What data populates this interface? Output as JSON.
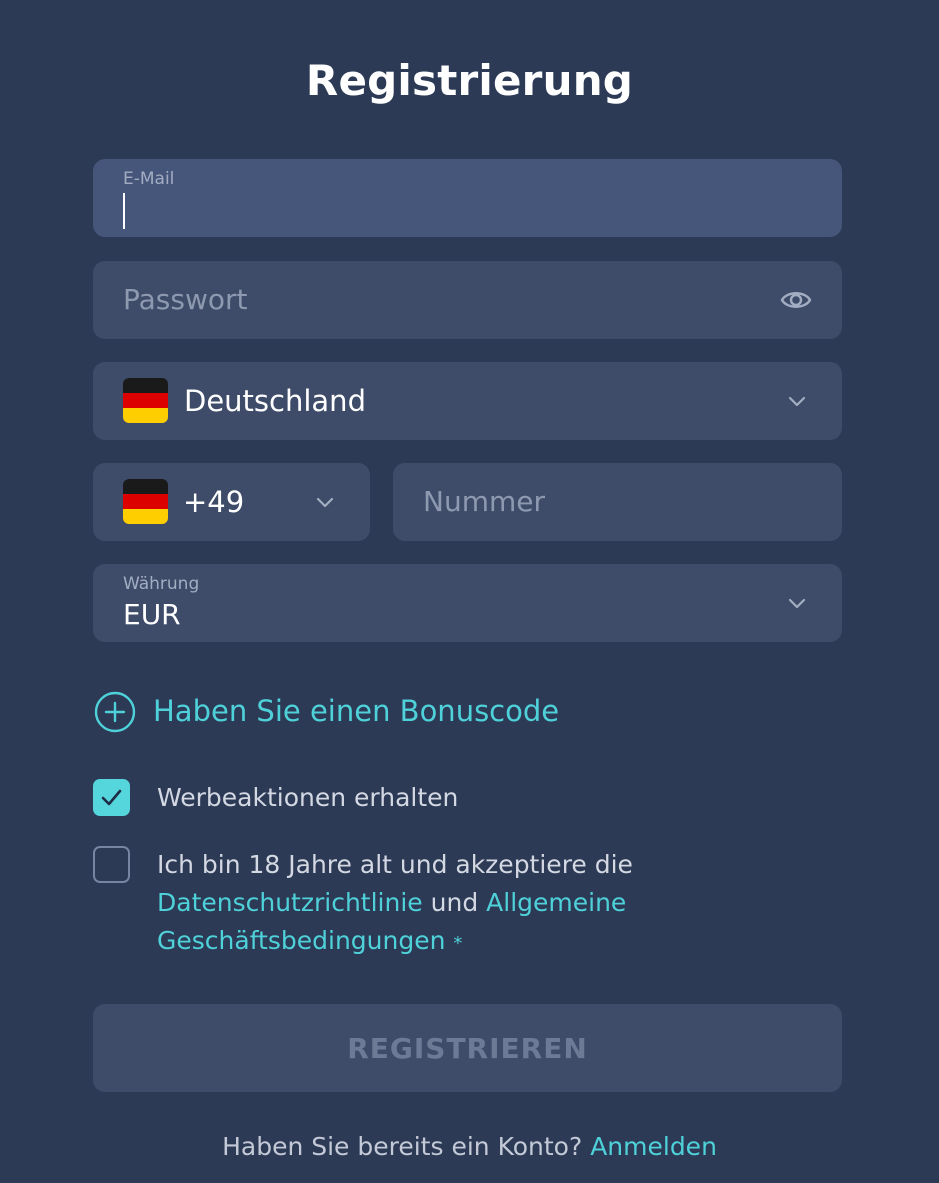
{
  "title": "Registrierung",
  "email": {
    "label": "E-Mail",
    "value": ""
  },
  "password": {
    "placeholder": "Passwort"
  },
  "country": {
    "name": "Deutschland",
    "flag": "flag-germany"
  },
  "phone": {
    "code": "+49",
    "flag": "flag-germany",
    "placeholder": "Nummer"
  },
  "currency": {
    "label": "Währung",
    "value": "EUR"
  },
  "bonus": {
    "label": "Haben Sie einen Bonuscode"
  },
  "promos": {
    "label": "Werbeaktionen erhalten",
    "checked": true
  },
  "terms": {
    "line1": "Ich bin 18 Jahre alt und akzeptiere die",
    "privacy_link": "Datenschutzrichtlinie",
    "and": "und",
    "terms_link_part1": "Allgemeine",
    "terms_link_part2": "Geschäftsbedingungen",
    "required_mark": "*",
    "checked": false
  },
  "submit": {
    "label": "REGISTRIEREN"
  },
  "footer": {
    "text": "Haben Sie bereits ein Konto?",
    "login_link": "Anmelden"
  },
  "colors": {
    "background": "#2c3a55",
    "field": "#3e4c6a",
    "accent": "#4fd1d9",
    "flag_black": "#000000",
    "flag_red": "#dd0000",
    "flag_gold": "#ffce00"
  }
}
